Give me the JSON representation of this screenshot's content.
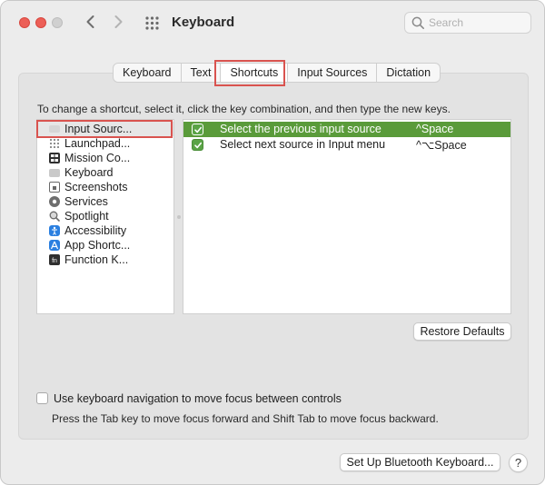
{
  "window": {
    "title": "Keyboard",
    "search_placeholder": "Search"
  },
  "tabs": [
    {
      "label": "Keyboard",
      "selected": false
    },
    {
      "label": "Text",
      "selected": false
    },
    {
      "label": "Shortcuts",
      "selected": true
    },
    {
      "label": "Input Sources",
      "selected": false
    },
    {
      "label": "Dictation",
      "selected": false
    }
  ],
  "instructions": "To change a shortcut, select it, click the key combination, and then type the new keys.",
  "categories": [
    {
      "label": "Input Sourc...",
      "icon": "input-sources-icon",
      "selected": true
    },
    {
      "label": "Launchpad...",
      "icon": "launchpad-icon",
      "selected": false
    },
    {
      "label": "Mission Co...",
      "icon": "mission-control-icon",
      "selected": false
    },
    {
      "label": "Keyboard",
      "icon": "keyboard-icon",
      "selected": false
    },
    {
      "label": "Screenshots",
      "icon": "screenshots-icon",
      "selected": false
    },
    {
      "label": "Services",
      "icon": "services-gear-icon",
      "selected": false
    },
    {
      "label": "Spotlight",
      "icon": "spotlight-magnifier-icon",
      "selected": false
    },
    {
      "label": "Accessibility",
      "icon": "accessibility-icon",
      "selected": false
    },
    {
      "label": "App Shortc...",
      "icon": "app-shortcuts-icon",
      "selected": false
    },
    {
      "label": "Function K...",
      "icon": "function-keys-icon",
      "selected": false
    }
  ],
  "shortcuts": [
    {
      "description": "Select the previous input source",
      "keys": "^Space",
      "checked": true,
      "selected": true
    },
    {
      "description": "Select next source in Input menu",
      "keys": "^⌥Space",
      "checked": true,
      "selected": false
    }
  ],
  "buttons": {
    "restore_defaults": "Restore Defaults",
    "bluetooth": "Set Up Bluetooth Keyboard...",
    "help": "?"
  },
  "keyboard_navigation": {
    "label": "Use keyboard navigation to move focus between controls",
    "help_text": "Press the Tab key to move focus forward and Shift Tab to move focus backward.",
    "checked": false
  },
  "colors": {
    "selection_green": "#5a9b3a",
    "annotation_red": "#d9534f"
  }
}
